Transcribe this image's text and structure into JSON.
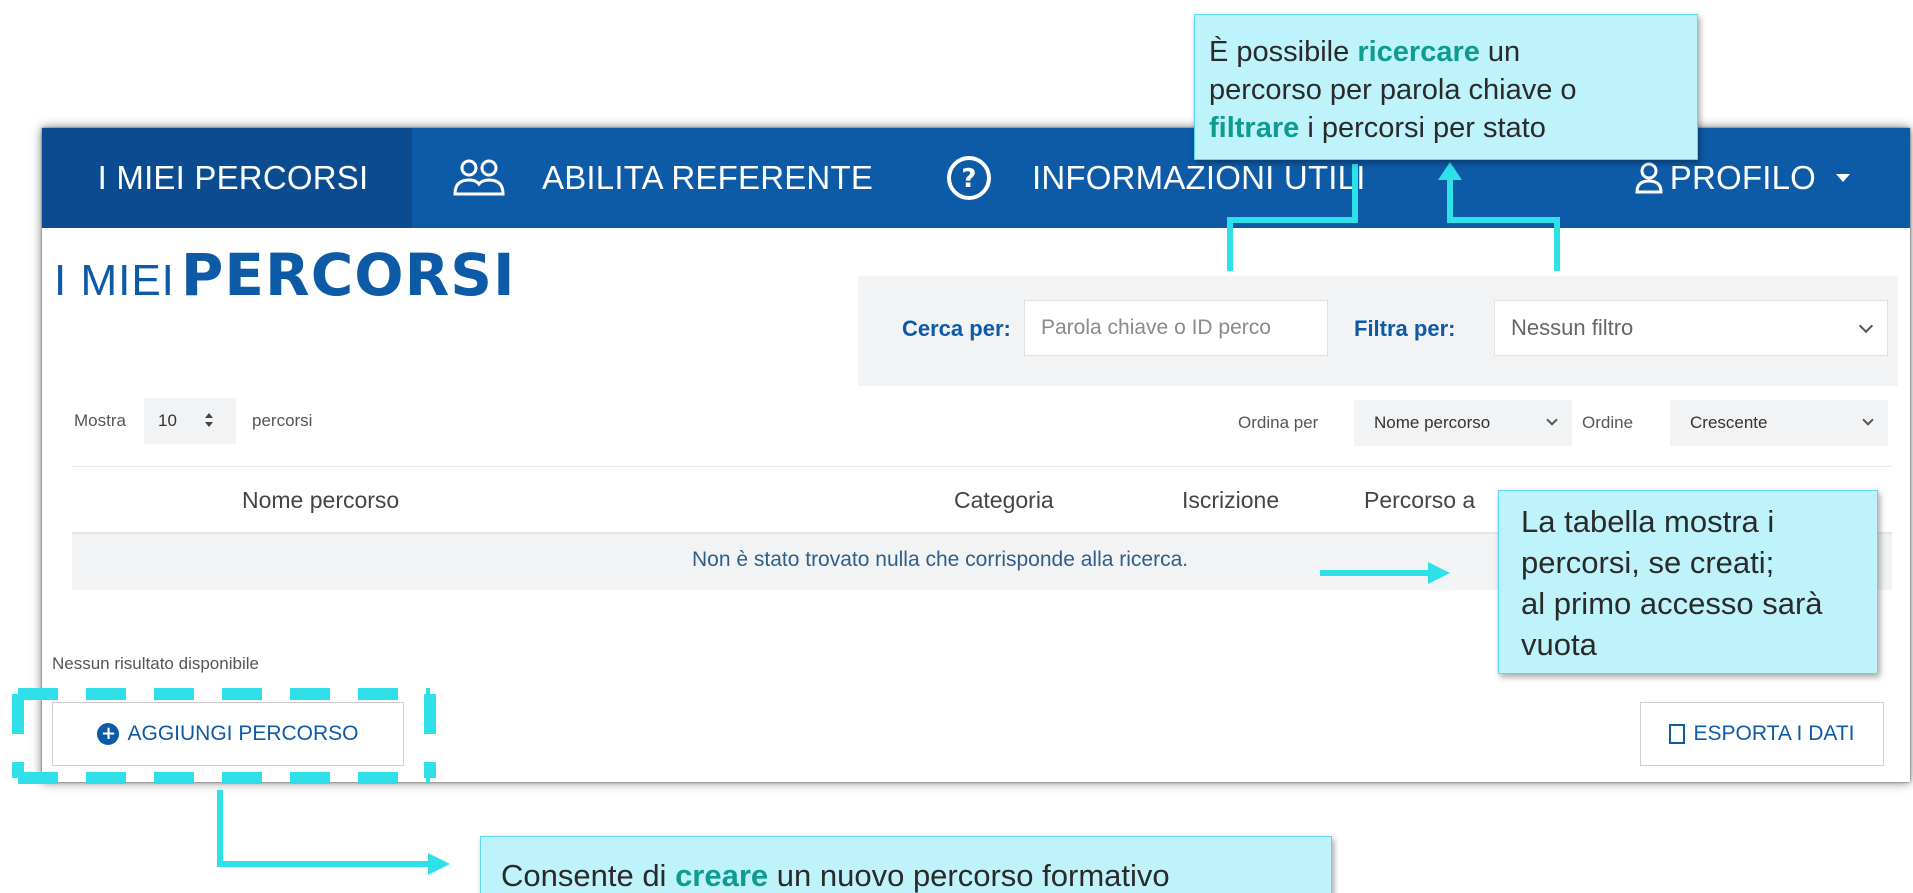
{
  "navbar": {
    "my_paths": "I MIEI PERCORSI",
    "enable_referent": "ABILITA REFERENTE",
    "useful_info": "INFORMAZIONI UTILI",
    "profile": "PROFILO"
  },
  "page_title": {
    "light": "I MIEI",
    "bold": "PERCORSI"
  },
  "search": {
    "search_label": "Cerca per:",
    "search_placeholder": "Parola chiave o ID perco",
    "filter_label": "Filtra per:",
    "filter_value": "Nessun filtro"
  },
  "list_controls": {
    "show_label": "Mostra",
    "show_value": "10",
    "show_suffix": "percorsi",
    "sort_label": "Ordina per",
    "sort_value": "Nome percorso",
    "order_label": "Ordine",
    "order_value": "Crescente"
  },
  "table": {
    "columns": [
      "Nome percorso",
      "Categoria",
      "Iscrizione",
      "Percorso a"
    ],
    "empty_message": "Non è stato trovato nulla che corrisponde alla ricerca."
  },
  "no_results": "Nessun risultato disponibile",
  "buttons": {
    "add_path": "AGGIUNGI PERCORSO",
    "export": "ESPORTA I DATI"
  },
  "callouts": {
    "search": {
      "line1_pre": "È possibile ",
      "line1_kw": "ricercare",
      "line1_post": " un",
      "line2": "percorso per parola chiave o",
      "line3_kw": "filtrare",
      "line3_post": " i percorsi per stato"
    },
    "table": {
      "line1": "La tabella mostra i",
      "line2": "percorsi, se creati;",
      "line3": "al primo accesso sarà",
      "line4": "vuota"
    },
    "add": {
      "pre": "Consente di ",
      "kw": "creare",
      "post": " un nuovo percorso formativo"
    }
  },
  "colors": {
    "navbar": "#0d5aa7",
    "accent": "#0f9c8f",
    "callout_bg": "#bff3fb",
    "arrow": "#2fe0e8"
  }
}
